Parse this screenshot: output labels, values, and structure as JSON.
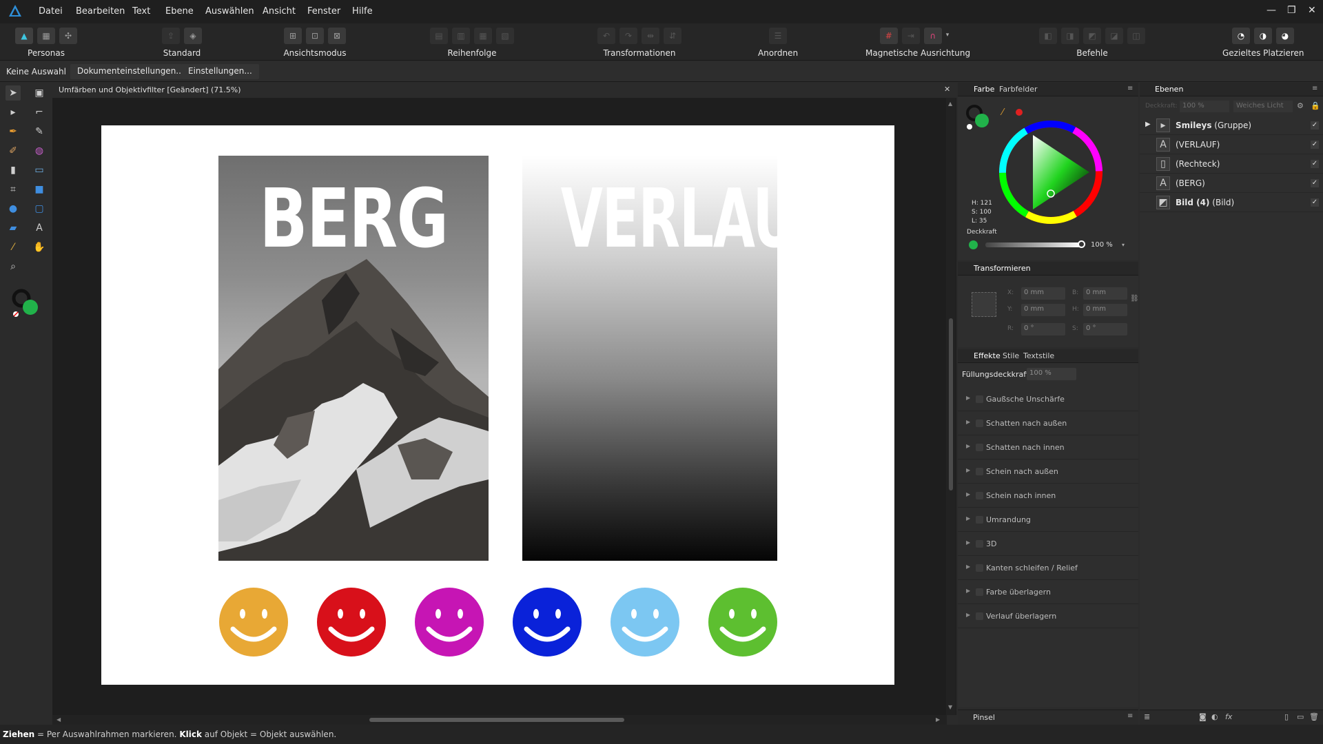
{
  "menu": {
    "items": [
      "Datei",
      "Bearbeiten",
      "Text",
      "Ebene",
      "Auswählen",
      "Ansicht",
      "Fenster",
      "Hilfe"
    ],
    "window_controls": [
      "—",
      "❐",
      "✕"
    ]
  },
  "toolbar": {
    "personas": "Personas",
    "standard": "Standard",
    "ansichtsmodus": "Ansichtsmodus",
    "reihenfolge": "Reihenfolge",
    "transformationen": "Transformationen",
    "anordnen": "Anordnen",
    "magnetische": "Magnetische Ausrichtung",
    "befehle": "Befehle",
    "gezieltes": "Gezieltes Platzieren"
  },
  "context": {
    "selection": "Keine Auswahl",
    "doc_settings": "Dokumenteinstellungen...",
    "settings": "Einstellungen..."
  },
  "document": {
    "title": "Umfärben und Objektivfilter [Geändert] (71.5%)",
    "close": "✕",
    "berg": "BERG",
    "verlauf": "VERLAUF"
  },
  "smileys": [
    "#e8a835",
    "#d8101a",
    "#c615b4",
    "#0a22d9",
    "#7cc7f2",
    "#5dbf30"
  ],
  "color_panel": {
    "tabs": [
      "Farbe",
      "Farbfelder"
    ],
    "h": "H: 121",
    "s": "S: 100",
    "l": "L: 35",
    "opacity_label": "Deckkraft",
    "opacity_value": "100 %",
    "fill_color": "#21b24a",
    "opacity_level": 1.0
  },
  "transform_panel": {
    "title": "Transformieren",
    "x": "0 mm",
    "y": "0 mm",
    "w": "0 mm",
    "h": "0 mm",
    "r": "0 °",
    "s": "0 °",
    "lx": "X:",
    "ly": "Y:",
    "lw": "B:",
    "lh": "H:",
    "lr": "R:",
    "ls": "S:"
  },
  "effects_panel": {
    "tabs": [
      "Effekte",
      "Stile",
      "Textstile"
    ],
    "fill_opacity_label": "Füllungsdeckkraft:",
    "fill_opacity_value": "100 %",
    "effects": [
      "Gaußsche Unschärfe",
      "Schatten nach außen",
      "Schatten nach innen",
      "Schein nach außen",
      "Schein nach innen",
      "Umrandung",
      "3D",
      "Kanten schleifen / Relief",
      "Farbe überlagern",
      "Verlauf überlagern"
    ]
  },
  "brush_panel": {
    "title": "Pinsel"
  },
  "layers_panel": {
    "title": "Ebenen",
    "opacity_label": "Deckkraft:",
    "opacity": "100 %",
    "blend": "Weiches Licht",
    "layers": [
      {
        "name": "Smileys",
        "suffix": " (Gruppe)",
        "bold": true,
        "icon": "group"
      },
      {
        "name": "(VERLAUF)",
        "suffix": "",
        "bold": false,
        "icon": "text"
      },
      {
        "name": "(Rechteck)",
        "suffix": "",
        "bold": false,
        "icon": "rect"
      },
      {
        "name": "(BERG)",
        "suffix": "",
        "bold": false,
        "icon": "text"
      },
      {
        "name": "Bild (4)",
        "suffix": " (Bild)",
        "bold": true,
        "icon": "image"
      }
    ]
  },
  "status": {
    "drag_bold": "Ziehen",
    "drag_text": " = Per Auswahlrahmen markieren. ",
    "click_bold": "Klick",
    "click_text": " auf Objekt = Objekt auswählen."
  }
}
